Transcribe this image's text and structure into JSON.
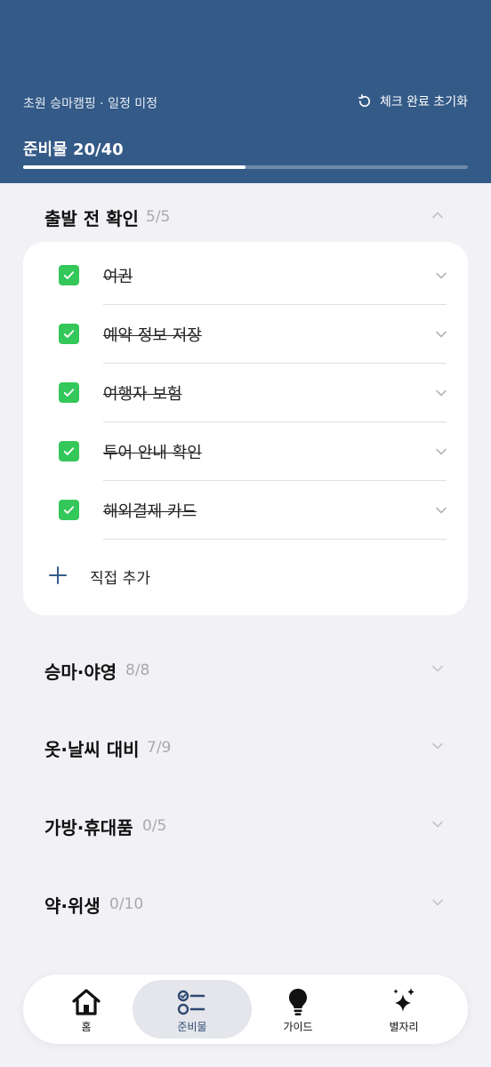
{
  "header": {
    "trip_title": "초원 승마캠핑 · 일정 미정",
    "reset_label": "체크 완료 초기화",
    "progress_label": "준비물 20/40",
    "progress_fraction": 0.5
  },
  "sections": [
    {
      "title": "출발 전 확인",
      "count": "5/5",
      "expanded": true
    },
    {
      "title": "승마·야영",
      "count": "8/8",
      "expanded": false
    },
    {
      "title": "옷·날씨 대비",
      "count": "7/9",
      "expanded": false
    },
    {
      "title": "가방·휴대품",
      "count": "0/5",
      "expanded": false
    },
    {
      "title": "약·위생",
      "count": "0/10",
      "expanded": false
    }
  ],
  "items": [
    {
      "label": "여권",
      "checked": true
    },
    {
      "label": "예약 정보 저장",
      "checked": true
    },
    {
      "label": "여행자 보험",
      "checked": true
    },
    {
      "label": "투어 안내 확인",
      "checked": true
    },
    {
      "label": "해외결제 카드",
      "checked": true
    }
  ],
  "add_label": "직접 추가",
  "nav": [
    {
      "label": "홈",
      "icon": "home-icon"
    },
    {
      "label": "준비물",
      "icon": "checklist-icon",
      "active": true
    },
    {
      "label": "가이드",
      "icon": "lightbulb-icon"
    },
    {
      "label": "별자리",
      "icon": "sparkles-icon"
    }
  ],
  "colors": {
    "header_bg": "#345a87",
    "check_green": "#34c759",
    "nav_active_bg": "#e4e6eb"
  }
}
